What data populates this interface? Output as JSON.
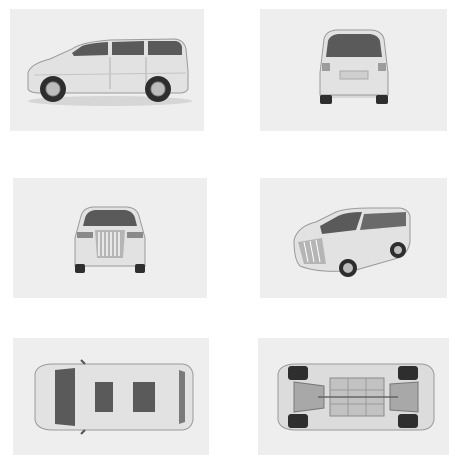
{
  "colors": {
    "panel_background": "#eeeeee",
    "body_paint": "#e2e2e2",
    "glass": "#5a5a5a",
    "tire": "#2e2e2e",
    "chrome": "#c8c8c8"
  },
  "views": [
    {
      "view": "side"
    },
    {
      "view": "rear"
    },
    {
      "view": "front"
    },
    {
      "view": "front-three-quarter"
    },
    {
      "view": "top"
    },
    {
      "view": "underbody"
    }
  ]
}
